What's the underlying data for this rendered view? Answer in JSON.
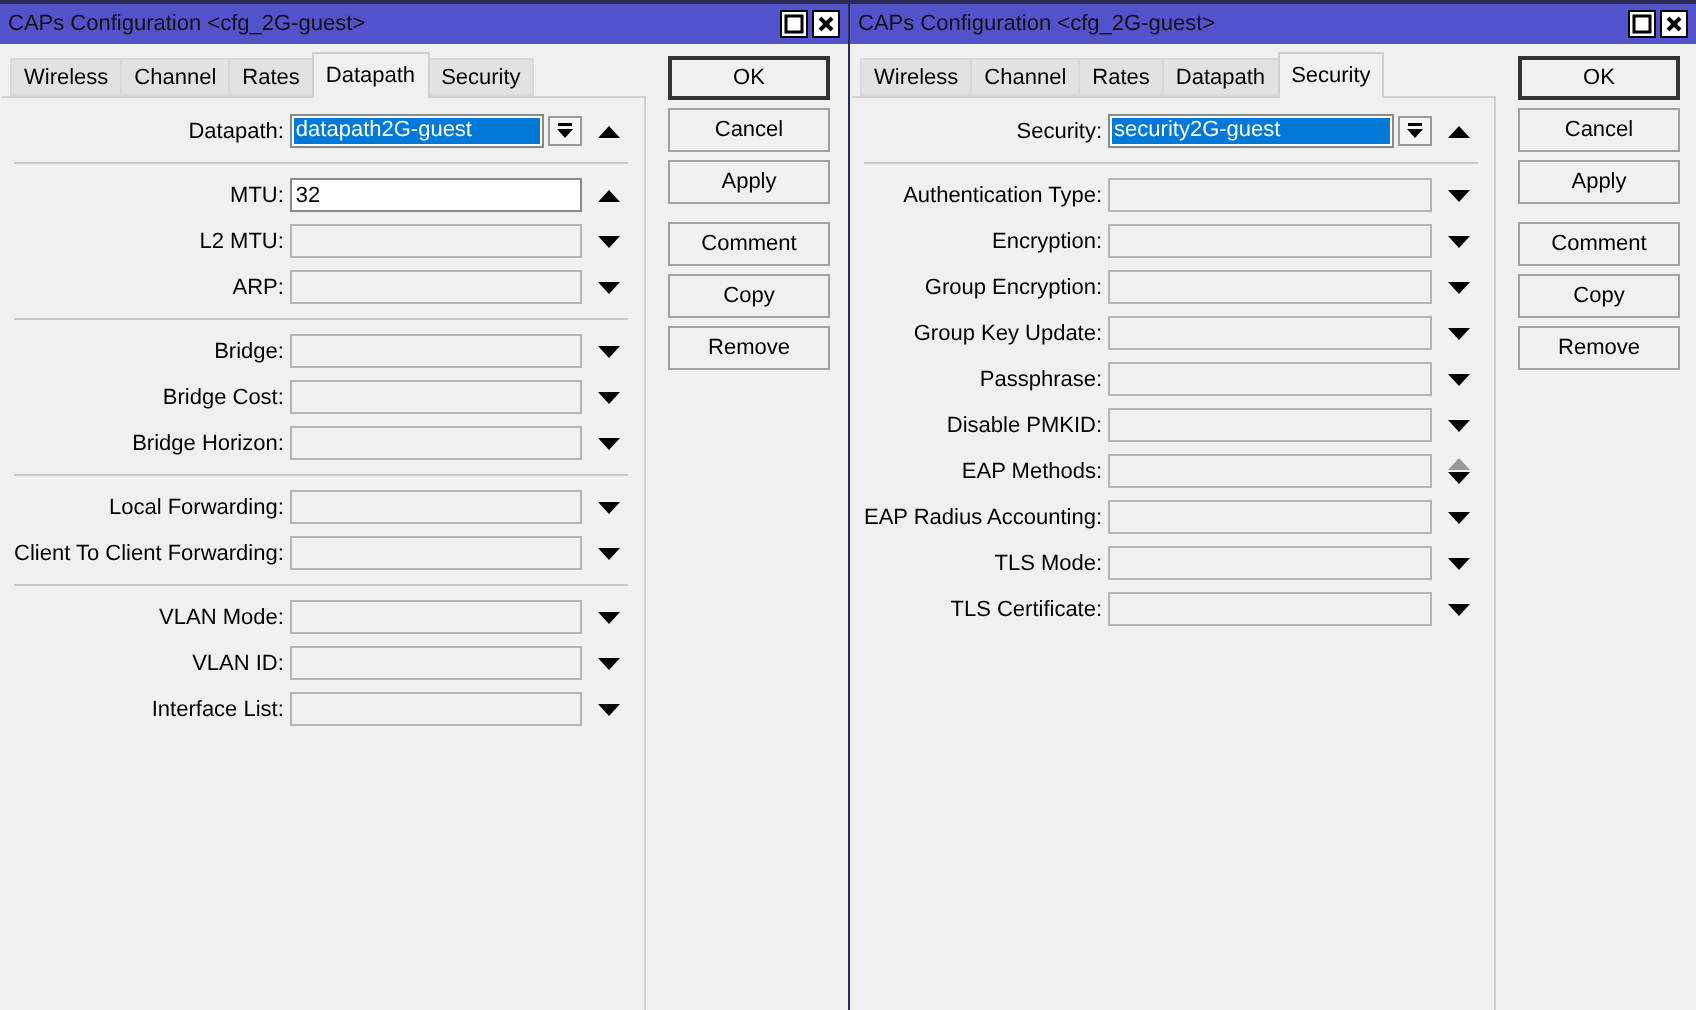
{
  "windows": [
    {
      "title": "CAPs Configuration <cfg_2G-guest>",
      "controls": [
        {
          "kind": "maximize"
        },
        {
          "kind": "close"
        }
      ],
      "tabs": [
        {
          "label": "Wireless",
          "selected": false
        },
        {
          "label": "Channel",
          "selected": false
        },
        {
          "label": "Rates",
          "selected": false
        },
        {
          "label": "Datapath",
          "selected": true
        },
        {
          "label": "Security",
          "selected": false
        }
      ],
      "sections": [
        [
          {
            "label": "Datapath:",
            "kind": "combo",
            "value": "datapath2G-guest",
            "spinner": {
              "kind": "up"
            }
          }
        ],
        [
          {
            "label": "MTU:",
            "kind": "input",
            "value": "32",
            "spinner": {
              "kind": "up"
            }
          },
          {
            "label": "L2 MTU:",
            "kind": "empty",
            "spinner": {
              "kind": "down"
            }
          },
          {
            "label": "ARP:",
            "kind": "empty",
            "spinner": {
              "kind": "down"
            }
          }
        ],
        [
          {
            "label": "Bridge:",
            "kind": "empty",
            "spinner": {
              "kind": "down"
            }
          },
          {
            "label": "Bridge Cost:",
            "kind": "empty",
            "spinner": {
              "kind": "down"
            }
          },
          {
            "label": "Bridge Horizon:",
            "kind": "empty",
            "spinner": {
              "kind": "down"
            }
          }
        ],
        [
          {
            "label": "Local Forwarding:",
            "kind": "empty",
            "spinner": {
              "kind": "down"
            }
          },
          {
            "label": "Client To Client Forwarding:",
            "kind": "empty",
            "spinner": {
              "kind": "down"
            }
          }
        ],
        [
          {
            "label": "VLAN Mode:",
            "kind": "empty",
            "spinner": {
              "kind": "down"
            }
          },
          {
            "label": "VLAN ID:",
            "kind": "empty",
            "spinner": {
              "kind": "down"
            }
          },
          {
            "label": "Interface List:",
            "kind": "empty",
            "spinner": {
              "kind": "down"
            }
          }
        ]
      ],
      "buttons": [
        [
          {
            "label": "OK",
            "default": true
          },
          {
            "label": "Cancel",
            "default": false
          },
          {
            "label": "Apply",
            "default": false
          }
        ],
        [
          {
            "label": "Comment",
            "default": false
          },
          {
            "label": "Copy",
            "default": false
          },
          {
            "label": "Remove",
            "default": false
          }
        ]
      ]
    },
    {
      "title": "CAPs Configuration <cfg_2G-guest>",
      "controls": [
        {
          "kind": "maximize"
        },
        {
          "kind": "close"
        }
      ],
      "tabs": [
        {
          "label": "Wireless",
          "selected": false
        },
        {
          "label": "Channel",
          "selected": false
        },
        {
          "label": "Rates",
          "selected": false
        },
        {
          "label": "Datapath",
          "selected": false
        },
        {
          "label": "Security",
          "selected": true
        }
      ],
      "sections": [
        [
          {
            "label": "Security:",
            "kind": "combo",
            "value": "security2G-guest",
            "spinner": {
              "kind": "up"
            }
          }
        ],
        [
          {
            "label": "Authentication Type:",
            "kind": "empty",
            "spinner": {
              "kind": "down"
            }
          },
          {
            "label": "Encryption:",
            "kind": "empty",
            "spinner": {
              "kind": "down"
            }
          },
          {
            "label": "Group Encryption:",
            "kind": "empty",
            "spinner": {
              "kind": "down"
            }
          },
          {
            "label": "Group Key Update:",
            "kind": "empty",
            "spinner": {
              "kind": "down"
            }
          },
          {
            "label": "Passphrase:",
            "kind": "empty",
            "spinner": {
              "kind": "down"
            }
          },
          {
            "label": "Disable PMKID:",
            "kind": "empty",
            "spinner": {
              "kind": "down"
            }
          },
          {
            "label": "EAP Methods:",
            "kind": "empty",
            "spinner": {
              "kind": "updown"
            }
          },
          {
            "label": "EAP Radius Accounting:",
            "kind": "empty",
            "spinner": {
              "kind": "down"
            }
          },
          {
            "label": "TLS Mode:",
            "kind": "empty",
            "spinner": {
              "kind": "down"
            }
          },
          {
            "label": "TLS Certificate:",
            "kind": "empty",
            "spinner": {
              "kind": "down"
            }
          }
        ]
      ],
      "buttons": [
        [
          {
            "label": "OK",
            "default": true
          },
          {
            "label": "Cancel",
            "default": false
          },
          {
            "label": "Apply",
            "default": false
          }
        ],
        [
          {
            "label": "Comment",
            "default": false
          },
          {
            "label": "Copy",
            "default": false
          },
          {
            "label": "Remove",
            "default": false
          }
        ]
      ]
    }
  ]
}
